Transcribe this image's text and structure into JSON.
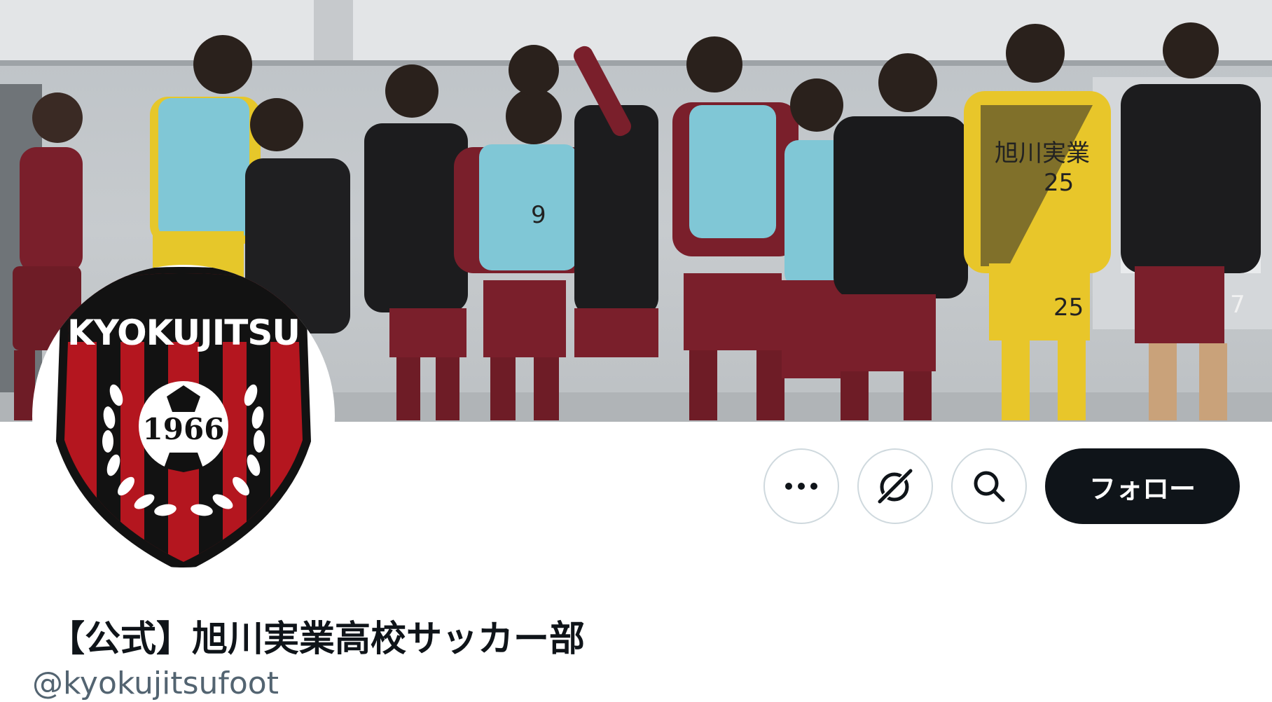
{
  "profile": {
    "display_name": "【公式】旭川実業高校サッカー部",
    "handle": "@kyokujitsufoot"
  },
  "avatar": {
    "crest_title": "KYOKUJITSU",
    "crest_year": "1966",
    "colors": {
      "red": "#b4161f",
      "black": "#121212",
      "white": "#ffffff"
    }
  },
  "actions": {
    "more_icon": "more-horizontal-icon",
    "grok_icon": "grok-icon",
    "search_icon": "search-icon",
    "follow_label": "フォロー"
  },
  "banner": {
    "image": "team-celebration-photo",
    "colors": {
      "maroon": "#7a1f2b",
      "bib": "#7fc4d4",
      "keeper": "#e8c62a",
      "jacket": "#1c1c1e"
    }
  },
  "theme": {
    "text_primary": "#0f1419",
    "text_secondary": "#536471",
    "button_border": "#cfd9de",
    "follow_bg": "#0f1419"
  }
}
